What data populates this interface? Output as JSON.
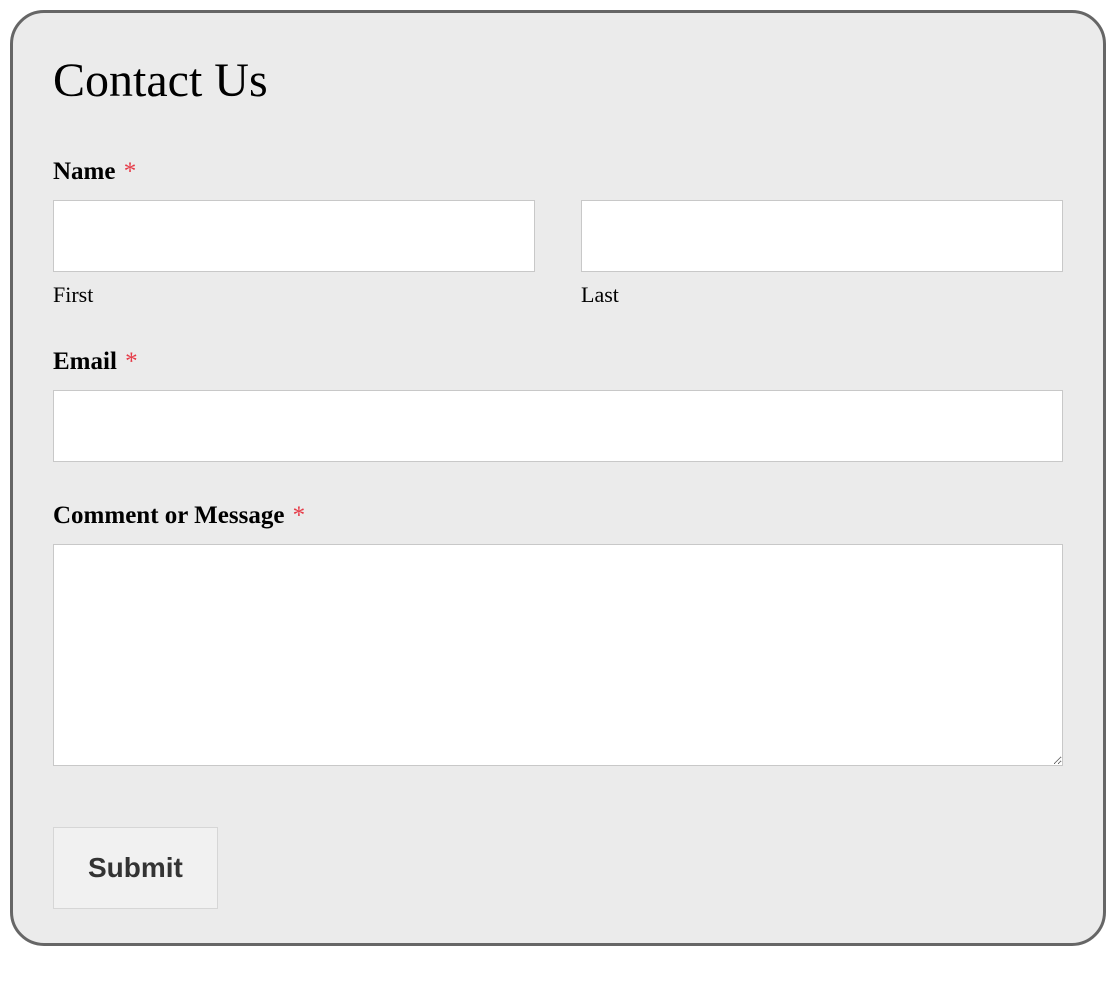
{
  "form": {
    "title": "Contact Us",
    "required_mark": "*",
    "fields": {
      "name": {
        "label": "Name",
        "first_sublabel": "First",
        "last_sublabel": "Last",
        "first_value": "",
        "last_value": ""
      },
      "email": {
        "label": "Email",
        "value": ""
      },
      "message": {
        "label": "Comment or Message",
        "value": ""
      }
    },
    "submit_label": "Submit"
  }
}
